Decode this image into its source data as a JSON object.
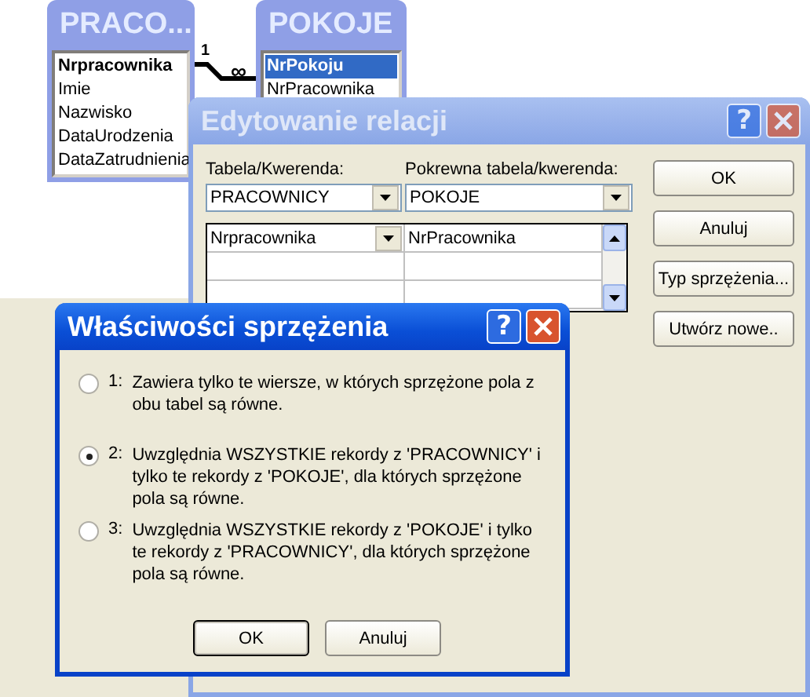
{
  "tables": [
    {
      "title": "PRACO...",
      "fields": [
        {
          "name": "Nrpracownika",
          "primary_key": true,
          "selected": false
        },
        {
          "name": "Imie",
          "primary_key": false,
          "selected": false
        },
        {
          "name": "Nazwisko",
          "primary_key": false,
          "selected": false
        },
        {
          "name": "DataUrodzenia",
          "primary_key": false,
          "selected": false
        },
        {
          "name": "DataZatrudnienia",
          "primary_key": false,
          "selected": false
        }
      ]
    },
    {
      "title": "POKOJE",
      "fields": [
        {
          "name": "NrPokoju",
          "primary_key": true,
          "selected": true
        },
        {
          "name": "NrPracownika",
          "primary_key": false,
          "selected": false
        }
      ]
    }
  ],
  "relationship": {
    "one_label": "1",
    "many_label": "∞"
  },
  "edit_dialog": {
    "title": "Edytowanie relacji",
    "help": "?",
    "active": false,
    "table_label": "Tabela/Kwerenda:",
    "related_label": "Pokrewna tabela/kwerenda:",
    "table_value": "PRACOWNICY",
    "related_value": "POKOJE",
    "field_rows": [
      {
        "left": "Nrpracownika",
        "right": "NrPracownika"
      }
    ],
    "buttons": [
      {
        "label": "OK",
        "default": false
      },
      {
        "label": "Anuluj",
        "default": false
      },
      {
        "label": "Typ sprzężenia...",
        "default": false
      },
      {
        "label": "Utwórz nowe..",
        "default": false
      }
    ]
  },
  "join_dialog": {
    "title": "Właściwości sprzężenia",
    "help": "?",
    "active": true,
    "options": [
      {
        "number": "1:",
        "text": "Zawiera tylko te wiersze, w których sprzężone pola z obu tabel są równe.",
        "selected": false
      },
      {
        "number": "2:",
        "text": "Uwzględnia WSZYSTKIE rekordy z 'PRACOWNICY' i tylko te rekordy z 'POKOJE', dla których sprzężone pola są równe.",
        "selected": true
      },
      {
        "number": "3:",
        "text": "Uwzględnia WSZYSTKIE rekordy z 'POKOJE' i tylko te rekordy z 'PRACOWNICY', dla których sprzężone pola są równe.",
        "selected": false
      }
    ],
    "buttons": [
      {
        "label": "OK",
        "default": true
      },
      {
        "label": "Anuluj",
        "default": false
      }
    ]
  }
}
